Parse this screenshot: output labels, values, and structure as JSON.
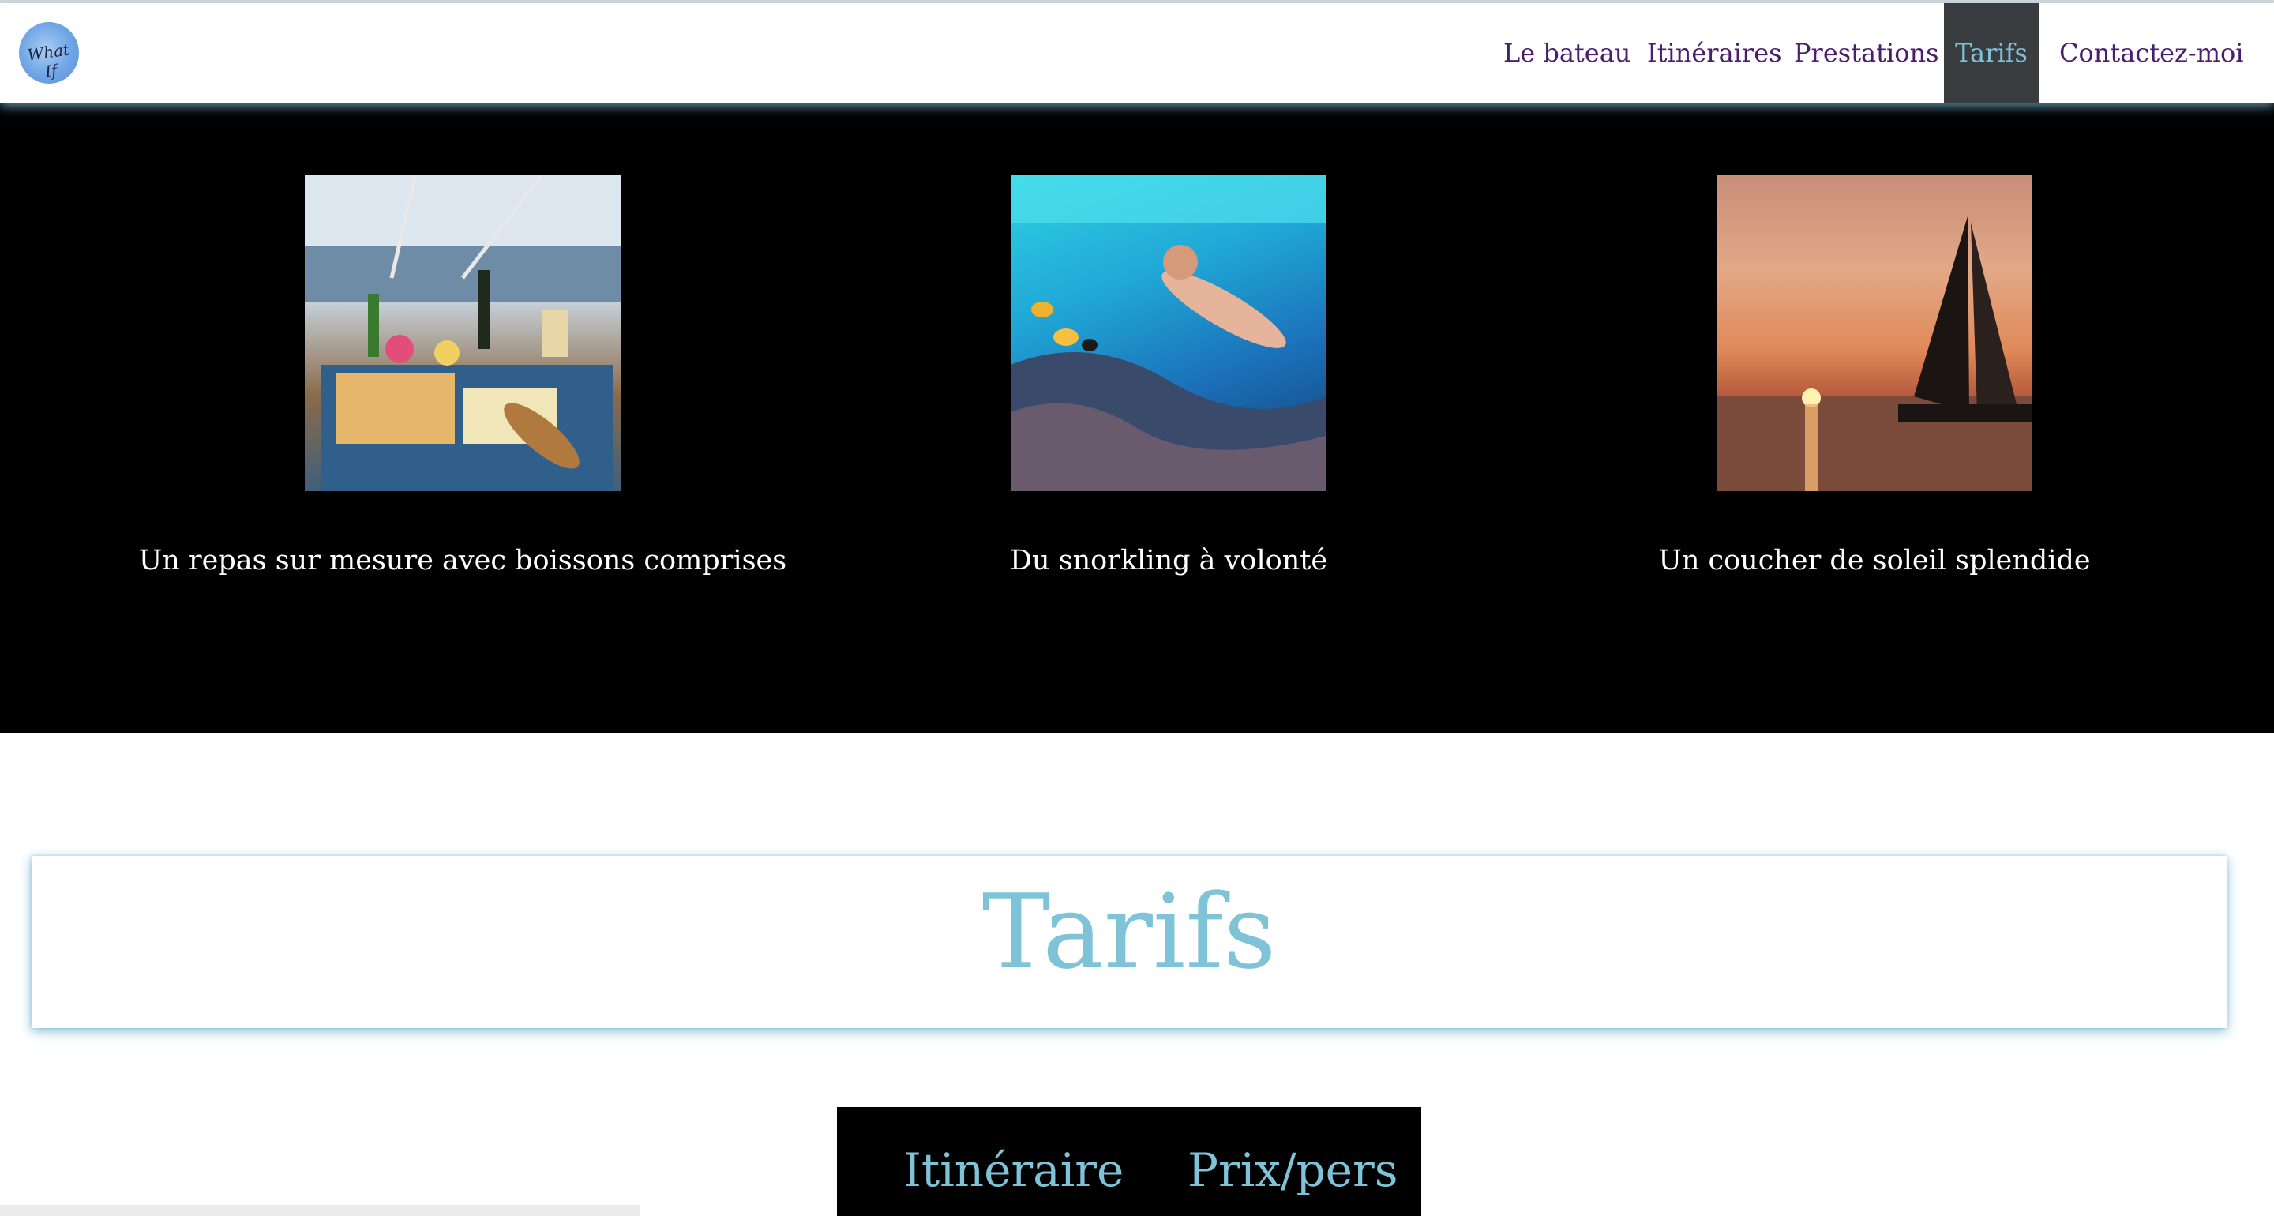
{
  "logo": {
    "text": "What If",
    "icon": "logo-icon"
  },
  "nav": {
    "items": [
      {
        "label": "Le bateau"
      },
      {
        "label": "Itinéraires"
      },
      {
        "label": "Prestations"
      },
      {
        "label": "Tarifs",
        "active": true
      },
      {
        "label": "Contactez-moi"
      }
    ],
    "active_bg": "#3a3d3f",
    "active_color": "#7fc1d8",
    "link_color": "#4a1d6e"
  },
  "gallery": {
    "items": [
      {
        "caption": "Un repas sur mesure avec boissons comprises",
        "image": "meal-on-boat-image"
      },
      {
        "caption": "Du snorkling à volonté",
        "image": "snorkeling-image"
      },
      {
        "caption": "Un coucher de soleil splendide",
        "image": "sunset-sailboat-image"
      }
    ]
  },
  "tarifs": {
    "title": "Tarifs",
    "table_headers": [
      "Itinéraire",
      "Prix/pers"
    ]
  },
  "colors": {
    "accent": "#7ec3d8",
    "gallery_bg": "#000000"
  }
}
